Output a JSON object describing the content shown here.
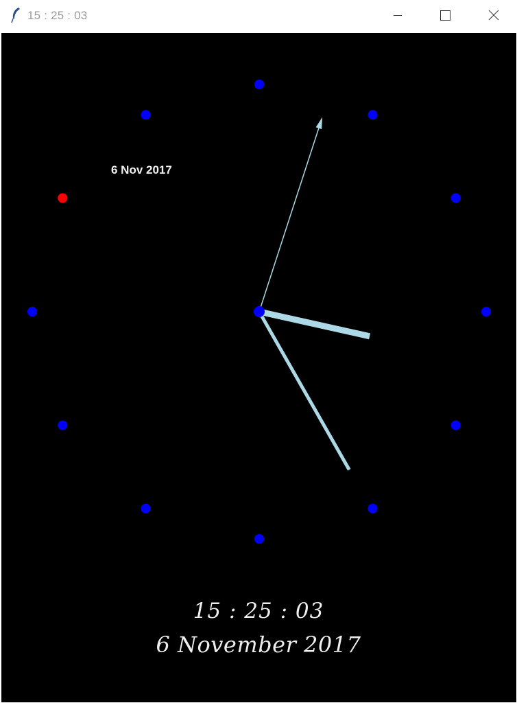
{
  "window": {
    "title": "15 : 25 : 03",
    "icon": "feather-icon",
    "controls": {
      "minimize": "minimize-icon",
      "maximize": "maximize-icon",
      "close": "close-icon"
    }
  },
  "clock": {
    "background_color": "#000000",
    "hour_marker_color": "#0000ff",
    "current_hour_marker_color": "#ff0000",
    "hand_color": "#add8e6",
    "time": {
      "hours": 15,
      "minutes": 25,
      "seconds": 3
    },
    "small_date": "6 Nov 2017",
    "digital_time": "15 : 25 : 03",
    "digital_date": "6 November 2017"
  }
}
